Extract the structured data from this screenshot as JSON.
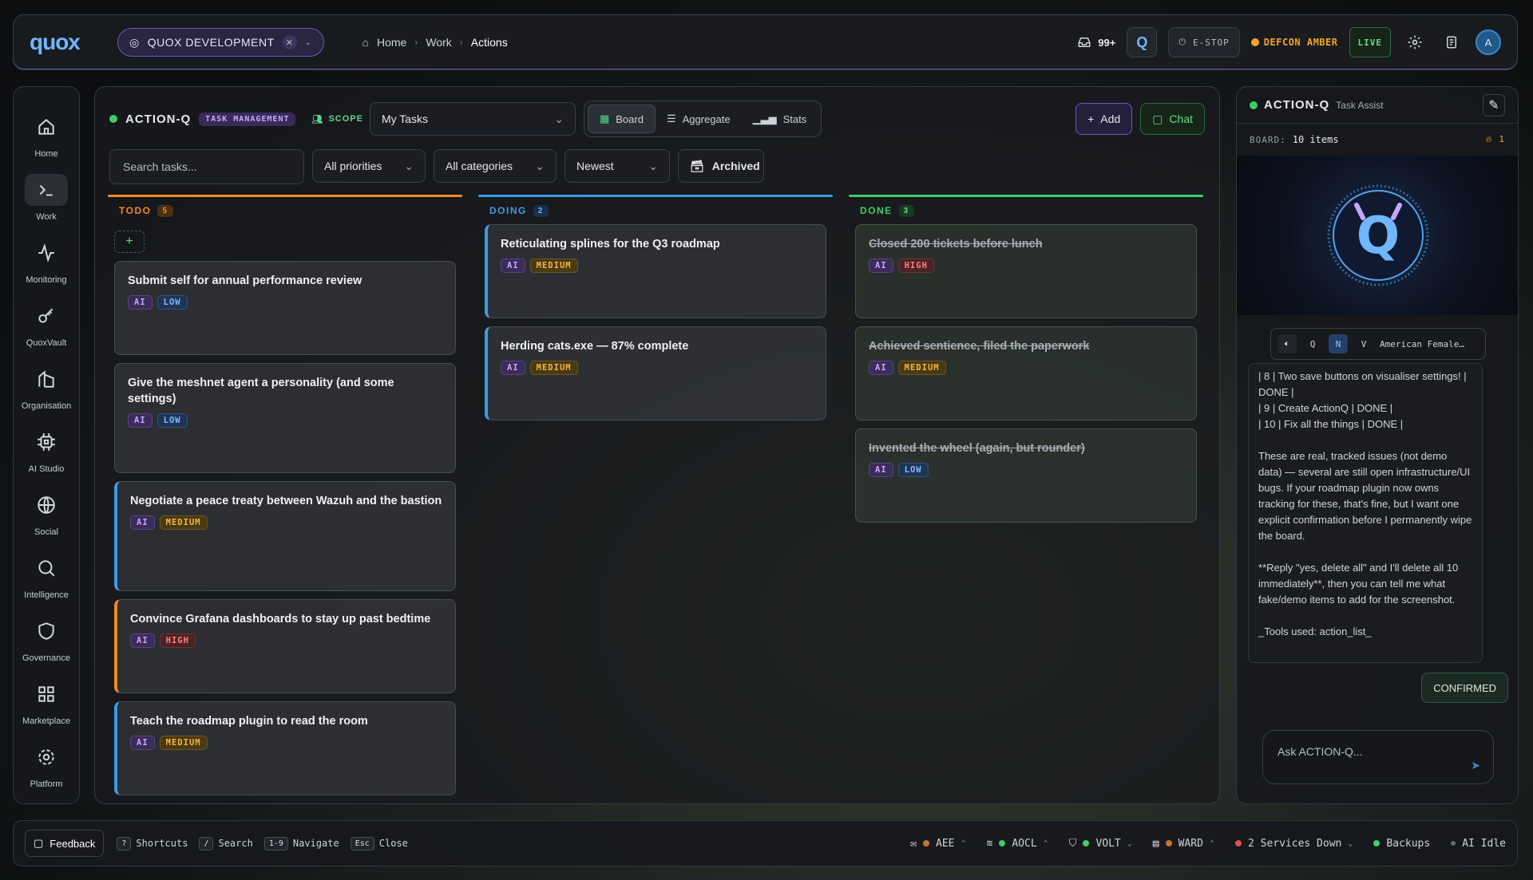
{
  "topbar": {
    "logo": "quox",
    "org": "QUOX DEVELOPMENT",
    "breadcrumbs": [
      "Home",
      "Work",
      "Actions"
    ],
    "inbox_count": "99+",
    "estop": "E-STOP",
    "defcon": "DEFCON AMBER",
    "live": "LIVE",
    "avatar": "A"
  },
  "nav": [
    {
      "label": "Home",
      "icon": "home-icon"
    },
    {
      "label": "Work",
      "icon": "terminal-icon"
    },
    {
      "label": "Monitoring",
      "icon": "pulse-icon"
    },
    {
      "label": "QuoxVault",
      "icon": "key-icon"
    },
    {
      "label": "Organisation",
      "icon": "building-icon"
    },
    {
      "label": "AI Studio",
      "icon": "chip-icon"
    },
    {
      "label": "Social",
      "icon": "globe-icon"
    },
    {
      "label": "Intelligence",
      "icon": "search-icon"
    },
    {
      "label": "Governance",
      "icon": "shield-icon"
    },
    {
      "label": "Marketplace",
      "icon": "grid-icon"
    },
    {
      "label": "Platform",
      "icon": "gear-icon"
    }
  ],
  "board": {
    "app_name": "ACTION-Q",
    "app_tag": "TASK MANAGEMENT",
    "scope_label": "SCOPE",
    "scope_value": "My Tasks",
    "views": [
      "Board",
      "Aggregate",
      "Stats"
    ],
    "add_label": "Add",
    "chat_label": "Chat",
    "search_placeholder": "Search tasks...",
    "priority_filter": "All priorities",
    "category_filter": "All categories",
    "sort": "Newest",
    "archived": "Archived",
    "columns": [
      {
        "name": "TODO",
        "count": "5",
        "cards": [
          {
            "title": "Submit self for annual performance review",
            "tag": "AI",
            "priority": "LOW"
          },
          {
            "title": "Give the meshnet agent a personality (and some settings)",
            "tag": "AI",
            "priority": "LOW"
          },
          {
            "title": "Negotiate a peace treaty between Wazuh and the bastion",
            "tag": "AI",
            "priority": "MEDIUM"
          },
          {
            "title": "Convince Grafana dashboards to stay up past bedtime",
            "tag": "AI",
            "priority": "HIGH"
          },
          {
            "title": "Teach the roadmap plugin to read the room",
            "tag": "AI",
            "priority": "MEDIUM"
          }
        ]
      },
      {
        "name": "DOING",
        "count": "2",
        "cards": [
          {
            "title": "Reticulating splines for the Q3 roadmap",
            "tag": "AI",
            "priority": "MEDIUM"
          },
          {
            "title": "Herding cats.exe — 87% complete",
            "tag": "AI",
            "priority": "MEDIUM"
          }
        ]
      },
      {
        "name": "DONE",
        "count": "3",
        "cards": [
          {
            "title": "Closed 200 tickets before lunch",
            "tag": "AI",
            "priority": "HIGH"
          },
          {
            "title": "Achieved sentience, filed the paperwork",
            "tag": "AI",
            "priority": "MEDIUM"
          },
          {
            "title": "Invented the wheel (again, but rounder)",
            "tag": "AI",
            "priority": "LOW"
          }
        ]
      }
    ]
  },
  "assist": {
    "title": "ACTION-Q",
    "subtitle": "Task Assist",
    "board_label": "BOARD:",
    "board_items": "10 items",
    "streak": "1",
    "voice_keys": [
      "Q",
      "N",
      "V"
    ],
    "voice_name": "American Female…",
    "message_lines": [
      "| 8 | Two save buttons on visualiser settings! | DONE |",
      "| 9 | Create ActionQ | DONE |",
      "| 10 | Fix all the things | DONE |"
    ],
    "message_p1": "These are real, tracked issues (not demo data) — several are still open infrastructure/UI bugs. If your roadmap plugin now owns tracking for these, that's fine, but I want one explicit confirmation before I permanently wipe the board.",
    "message_p2": "**Reply \"yes, delete all\" and I'll delete all 10 immediately**, then you can tell me what fake/demo items to add for the screenshot.",
    "message_p3": "_Tools used: action_list_",
    "confirm_label": "CONFIRMED",
    "input_placeholder": "Ask ACTION-Q..."
  },
  "bottombar": {
    "feedback": "Feedback",
    "shortcuts": [
      {
        "key": "?",
        "label": "Shortcuts"
      },
      {
        "key": "/",
        "label": "Search"
      },
      {
        "key": "1-9",
        "label": "Navigate"
      },
      {
        "key": "Esc",
        "label": "Close"
      }
    ],
    "status": [
      {
        "label": "AEE",
        "color": "#c9742a"
      },
      {
        "label": "AOCL",
        "color": "#3fcf6a"
      },
      {
        "label": "VOLT",
        "color": "#3fcf6a"
      },
      {
        "label": "WARD",
        "color": "#c9742a"
      },
      {
        "label": "2 Services Down",
        "color": "#e0524f"
      },
      {
        "label": "Backups",
        "color": "#3fcf6a"
      },
      {
        "label": "AI Idle",
        "color": "#666b72"
      }
    ]
  },
  "colors": {
    "todo": "#f08a24",
    "doing": "#3b9be6",
    "done": "#3fcf6a",
    "accent_purple": "#6a56c8"
  }
}
